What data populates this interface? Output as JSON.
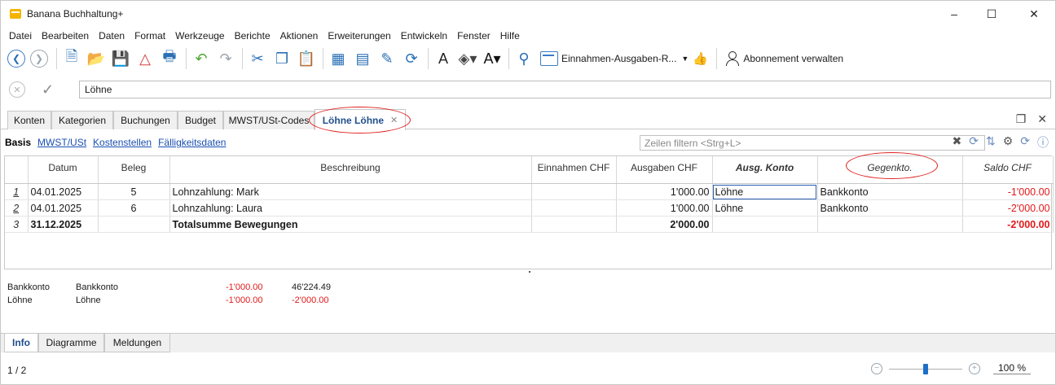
{
  "window": {
    "title": "Banana Buchhaltung+",
    "controls": {
      "minimize": "–",
      "maximize": "☐",
      "close": "✕"
    }
  },
  "menu": [
    "Datei",
    "Bearbeiten",
    "Daten",
    "Format",
    "Werkzeuge",
    "Berichte",
    "Aktionen",
    "Erweiterungen",
    "Entwickeln",
    "Fenster",
    "Hilfe"
  ],
  "toolbar": {
    "report_dropdown": "Einnahmen-Ausgaben-R...",
    "subscription": "Abonnement verwalten"
  },
  "editbar": {
    "value": "Löhne"
  },
  "tabs": [
    {
      "label": "Konten"
    },
    {
      "label": "Kategorien"
    },
    {
      "label": "Buchungen"
    },
    {
      "label": "Budget"
    },
    {
      "label": "MWST/USt-Codes"
    },
    {
      "label": "Löhne Löhne"
    }
  ],
  "views": [
    "Basis",
    "MWST/USt",
    "Kostenstellen",
    "Fälligkeitsdaten"
  ],
  "filter": {
    "placeholder": "Zeilen filtern <Strg+L>"
  },
  "table": {
    "headers": [
      "Datum",
      "Beleg",
      "Beschreibung",
      "Einnahmen CHF",
      "Ausgaben CHF",
      "Ausg. Konto",
      "Gegenkto.",
      "Saldo CHF"
    ],
    "rows": [
      {
        "n": "1",
        "date": "04.01.2025",
        "doc": "5",
        "desc": "Lohnzahlung: Mark",
        "income": "",
        "expense": "1'000.00",
        "account": "Löhne",
        "contra": "Bankkonto",
        "balance": "-1'000.00"
      },
      {
        "n": "2",
        "date": "04.01.2025",
        "doc": "6",
        "desc": "Lohnzahlung: Laura",
        "income": "",
        "expense": "1'000.00",
        "account": "Löhne",
        "contra": "Bankkonto",
        "balance": "-2'000.00"
      },
      {
        "n": "3",
        "date": "31.12.2025",
        "doc": "",
        "desc": "Totalsumme Bewegungen",
        "income": "",
        "expense": "2'000.00",
        "account": "",
        "contra": "",
        "balance": "-2'000.00"
      }
    ]
  },
  "info": [
    {
      "account": "Bankkonto",
      "name": "Bankkonto",
      "amount": "-1'000.00",
      "balance": "46'224.49"
    },
    {
      "account": "Löhne",
      "name": "Löhne",
      "amount": "-1'000.00",
      "balance": "-2'000.00"
    }
  ],
  "bottom_tabs": [
    "Info",
    "Diagramme",
    "Meldungen"
  ],
  "status": {
    "page": "1 / 2",
    "zoom": "100 %"
  },
  "colors": {
    "accent": "#1f4f8c",
    "negative": "#e21818",
    "highlight": "#e02020"
  }
}
